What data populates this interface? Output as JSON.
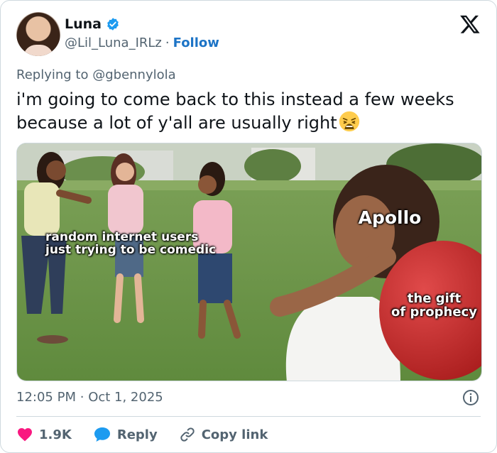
{
  "author": {
    "display_name": "Luna",
    "handle": "@Lil_Luna_IRLz",
    "separator": "·",
    "follow_label": "Follow"
  },
  "replying_to": {
    "prefix": "Replying to",
    "mention": "@gbennylola"
  },
  "tweet": {
    "text": "i'm going to come back to this instead a few weeks because a lot of y'all are usually right",
    "emoji": "tired-face-emoji"
  },
  "media": {
    "labels": {
      "users": "random internet users\njust trying to be comedic",
      "apollo": "Apollo",
      "gift": "the gift\nof prophecy"
    }
  },
  "meta": {
    "time": "12:05 PM",
    "separator": "·",
    "date": "Oct 1, 2025"
  },
  "actions": {
    "like_count": "1.9K",
    "reply_label": "Reply",
    "copy_label": "Copy link"
  },
  "colors": {
    "accent": "#1d74c6",
    "like": "#f91880",
    "verified": "#1d9bf0",
    "muted_text": "#536471"
  },
  "icons": [
    "verified-icon",
    "x-logo-icon",
    "info-icon",
    "heart-icon",
    "reply-bubble-icon",
    "link-icon"
  ]
}
